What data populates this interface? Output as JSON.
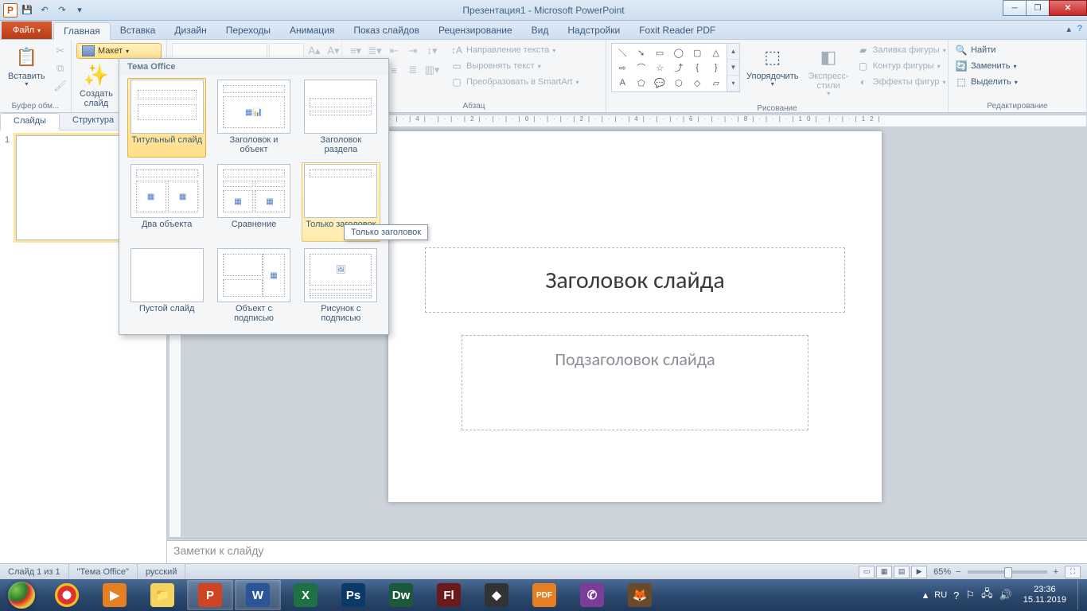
{
  "window": {
    "title": "Презентация1 - Microsoft PowerPoint",
    "app_letter": "P"
  },
  "tabs": {
    "file": "Файл",
    "home": "Главная",
    "insert": "Вставка",
    "design": "Дизайн",
    "transitions": "Переходы",
    "animations": "Анимация",
    "slideshow": "Показ слайдов",
    "review": "Рецензирование",
    "view": "Вид",
    "addins": "Надстройки",
    "foxit": "Foxit Reader PDF"
  },
  "ribbon": {
    "clipboard": {
      "paste": "Вставить",
      "group": "Буфер обм..."
    },
    "slides": {
      "new_slide": "Создать\nслайд",
      "layout": "Макет",
      "group": "..."
    },
    "paragraph": {
      "text_direction": "Направление текста",
      "align_text": "Выровнять текст",
      "convert_smartart": "Преобразовать в SmartArt",
      "group": "Абзац"
    },
    "drawing": {
      "arrange": "Упорядочить",
      "quick_styles": "Экспресс-стили",
      "shape_fill": "Заливка фигуры",
      "shape_outline": "Контур фигуры",
      "shape_effects": "Эффекты фигур",
      "group": "Рисование"
    },
    "editing": {
      "find": "Найти",
      "replace": "Заменить",
      "select": "Выделить",
      "group": "Редактирование"
    }
  },
  "layout_gallery": {
    "header": "Тема Office",
    "items": [
      "Титульный слайд",
      "Заголовок и объект",
      "Заголовок раздела",
      "Два объекта",
      "Сравнение",
      "Только заголовок",
      "Пустой слайд",
      "Объект с подписью",
      "Рисунок с подписью"
    ],
    "tooltip": "Только заголовок"
  },
  "slides_pane": {
    "tabs": {
      "slides": "Слайды",
      "outline": "Структура"
    },
    "thumb_number": "1"
  },
  "slide": {
    "title_placeholder": "Заголовок слайда",
    "subtitle_placeholder": "Подзаголовок слайда"
  },
  "notes": {
    "placeholder": "Заметки к слайду"
  },
  "ruler": {
    "marks": "|12|·|·|10|·|·|·|8|·|·|·|6|·|·|·|4|·|·|·|2|·|·|·|0|·|·|·|2|·|·|·|4|·|·|·|6|·|·|·|8|·|·|·|10|·|·|·|12|"
  },
  "status": {
    "slide_info": "Слайд 1 из 1",
    "theme": "\"Тема Office\"",
    "language": "русский",
    "zoom": "65%"
  },
  "tray": {
    "lang": "RU",
    "time": "23:36",
    "date": "15.11.2019"
  }
}
